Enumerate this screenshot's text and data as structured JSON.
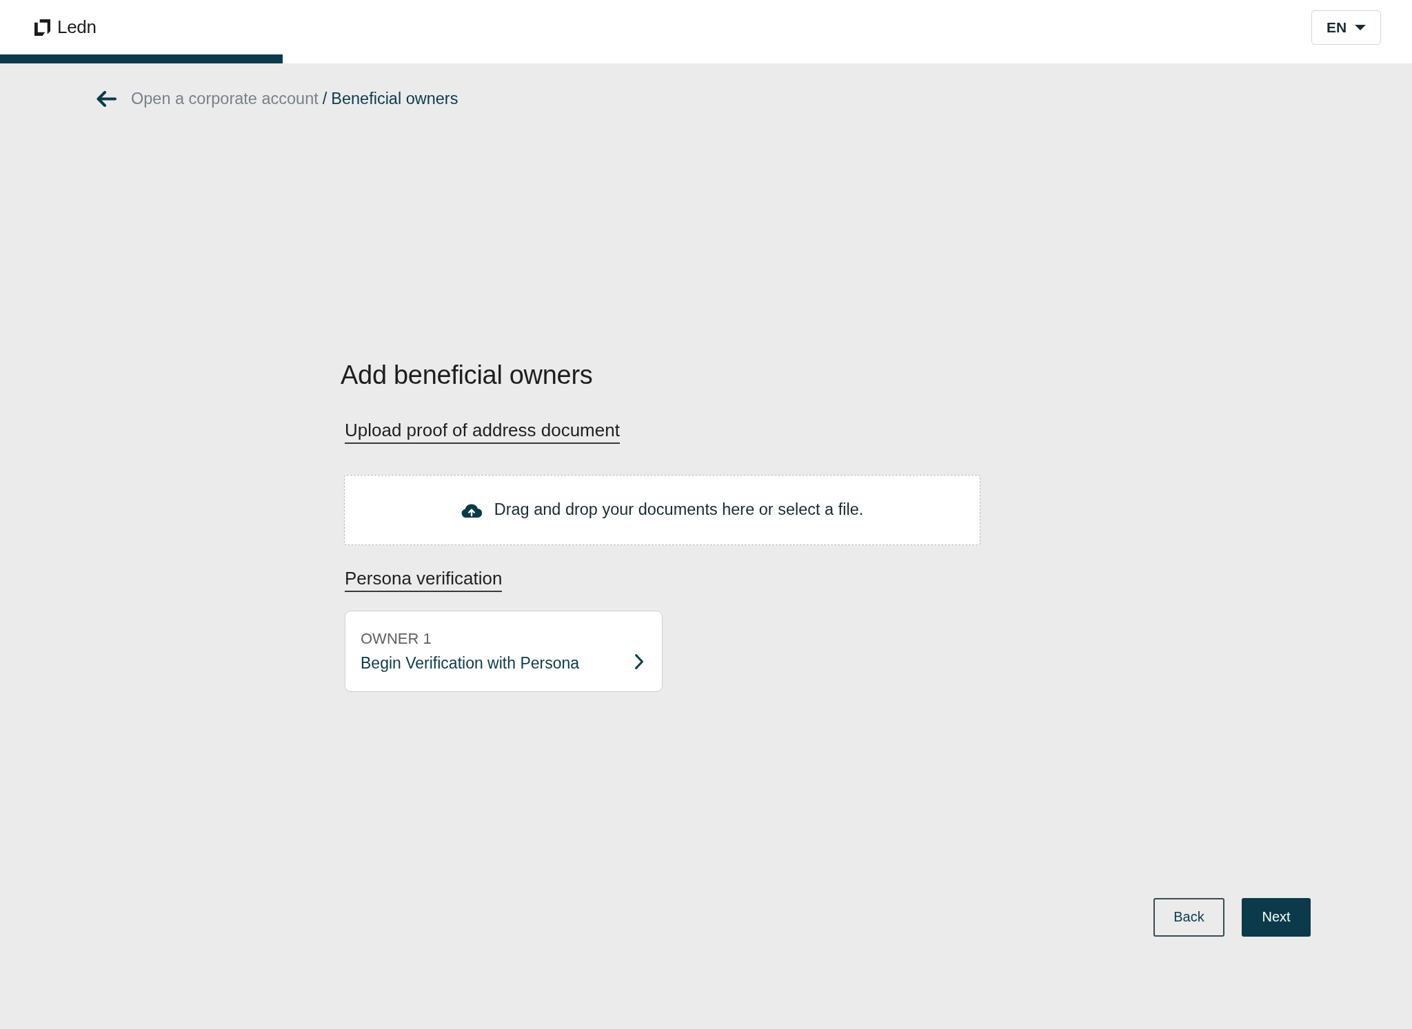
{
  "header": {
    "logo_text": "Ledn",
    "language": "EN",
    "progress": {
      "level": 0.2
    }
  },
  "breadcrumb": {
    "parent": "Open a corporate account",
    "separator": "/",
    "current": "Beneficial owners"
  },
  "title": "Add beneficial owners",
  "sections": [
    {
      "kind": "upload",
      "heading": "Upload proof of address document",
      "dropzone_text": "Drag and drop your documents here or select a file."
    },
    {
      "kind": "verification",
      "heading": "Persona verification",
      "owners": [
        {
          "label": "OWNER 1",
          "action": "Begin Verification with Persona"
        }
      ]
    }
  ],
  "buttons": [
    {
      "label": "Back",
      "kind": "secondary"
    },
    {
      "label": "Next",
      "kind": "primary"
    }
  ]
}
